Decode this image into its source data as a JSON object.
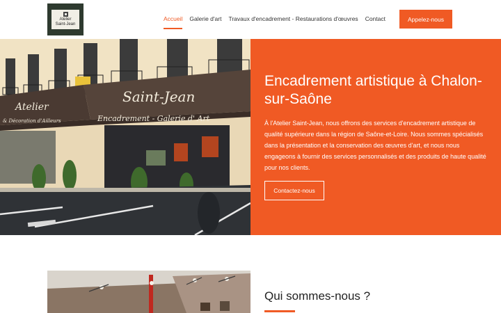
{
  "logo": {
    "line1": "Atelier",
    "line2": "Saint-Jean"
  },
  "nav": {
    "items": [
      {
        "label": "Accueil",
        "active": true
      },
      {
        "label": "Galerie d'art",
        "active": false
      },
      {
        "label": "Travaux d'encadrement - Restaurations d'œuvres",
        "active": false
      },
      {
        "label": "Contact",
        "active": false
      }
    ]
  },
  "header": {
    "cta_label": "Appelez-nous"
  },
  "hero": {
    "title": "Encadrement artistique à Chalon-sur-Saône",
    "text": "À l'Atelier Saint-Jean, nous offrons des services d'encadrement artistique de qualité supérieure dans la région de Saône-et-Loire. Nous sommes spécialisés dans la présentation et la conservation des œuvres d'art, et nous nous engageons à fournir des services personnalisés et des produits de haute qualité pour nos clients.",
    "button_label": "Contactez-nous",
    "awning_left": "Atelier",
    "awning_left_sub": "& Décoration d'Ailleurs",
    "awning_right": "Saint-Jean",
    "awning_right_sub": "Encadrement - Galerie d' Art"
  },
  "about": {
    "title": "Qui sommes-nous ?"
  },
  "colors": {
    "accent": "#f05a24",
    "logo_bg": "#2e3a2f"
  }
}
